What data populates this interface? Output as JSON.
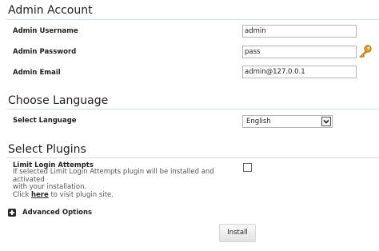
{
  "admin_account": {
    "title": "Admin Account",
    "username_label": "Admin Username",
    "username_value": "admin",
    "password_label": "Admin Password",
    "password_value": "pass",
    "email_label": "Admin Email",
    "email_value": "admin@127.0.0.1"
  },
  "language": {
    "title": "Choose Language",
    "select_label": "Select Language",
    "selected_value": "English"
  },
  "plugins": {
    "title": "Select Plugins",
    "limit_login_label": "Limit Login Attempts",
    "limit_login_checked": false,
    "desc_line1": "If selected Limit Login Attempts plugin will be installed and activated",
    "desc_line2": "with your installation.",
    "desc_click": "Click ",
    "desc_link": "here",
    "desc_after_link": " to visit plugin site."
  },
  "advanced": {
    "label": "Advanced Options",
    "icon": "plus-icon"
  },
  "actions": {
    "install_label": "Install"
  },
  "icons": {
    "password_generator": "key-icon"
  },
  "colors": {
    "rule": "#d4dde6",
    "key_icon": "#e0a224"
  }
}
